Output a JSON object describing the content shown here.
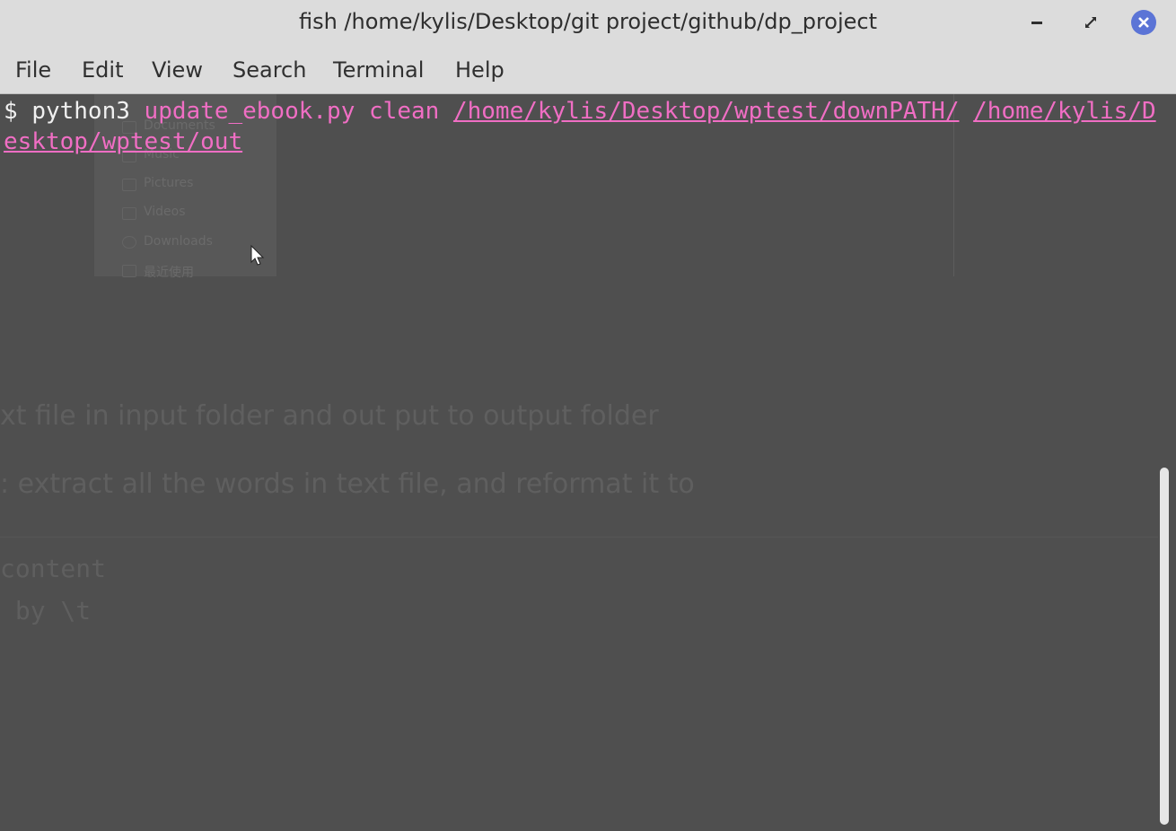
{
  "window": {
    "title": "fish /home/kylis/Desktop/git project/github/dp_project",
    "buttons": {
      "minimize_icon": "minimize-icon",
      "maximize_icon": "maximize-icon",
      "close_icon": "close-icon",
      "close_color": "#5b74d6"
    }
  },
  "menu": {
    "items": [
      {
        "label": "File"
      },
      {
        "label": "Edit"
      },
      {
        "label": "View"
      },
      {
        "label": "Search"
      },
      {
        "label": "Terminal"
      },
      {
        "label": "Help"
      }
    ]
  },
  "terminal": {
    "prompt": "$ ",
    "command": "python3",
    "arg1": "update_ebook.py",
    "arg2": "clean",
    "path1": "/home/kylis/Desktop/wptest/downPATH/",
    "path2": "/home/kylis/Desktop/wptest/out",
    "colors": {
      "background": "#4f4f4f",
      "text": "#f0f0f0",
      "argument": "#f06ec4"
    }
  },
  "ghost": {
    "sidebar_items": [
      "Documents",
      "Music",
      "Pictures",
      "Videos",
      "Downloads",
      "最近使用"
    ],
    "line1": "xt file in input folder and out put to output folder",
    "line2": ": extract all the words in text file, and reformat it to",
    "code1": "content",
    "code2": " by \\t"
  }
}
